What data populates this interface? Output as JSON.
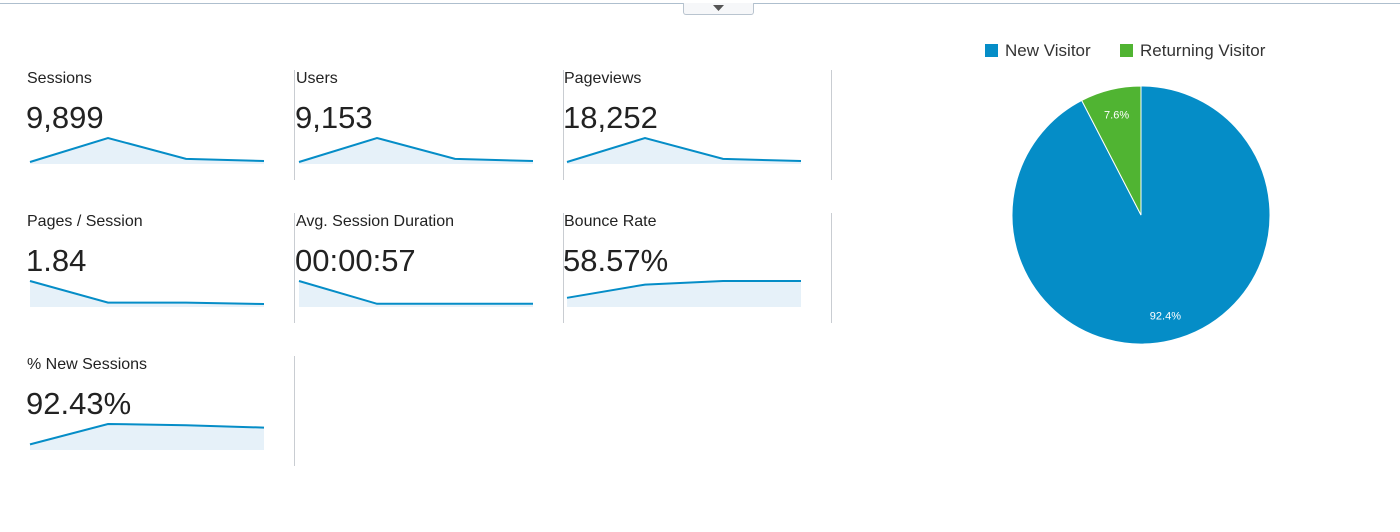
{
  "colors": {
    "new_visitor": "#058dc7",
    "returning_visitor": "#50b432",
    "sparkline": "#058dc7",
    "sparkline_fill": "#e6f1f9",
    "separator": "#c9cdd2"
  },
  "toggle": {
    "icon": "triangle-down-icon"
  },
  "metrics": [
    {
      "label": "Sessions",
      "value": "9,899",
      "trend": [
        0.0,
        1.0,
        0.13,
        0.04
      ]
    },
    {
      "label": "Users",
      "value": "9,153",
      "trend": [
        0.0,
        1.0,
        0.13,
        0.04
      ]
    },
    {
      "label": "Pageviews",
      "value": "18,252",
      "trend": [
        0.0,
        1.0,
        0.13,
        0.04
      ]
    },
    {
      "label": "Pages / Session",
      "value": "1.84",
      "trend": [
        1.0,
        0.1,
        0.1,
        0.04
      ]
    },
    {
      "label": "Avg. Session Duration",
      "value": "00:00:57",
      "trend": [
        1.0,
        0.05,
        0.05,
        0.05
      ]
    },
    {
      "label": "Bounce Rate",
      "value": "58.57%",
      "trend": [
        0.3,
        0.85,
        1.0,
        1.0
      ]
    },
    {
      "label": "% New Sessions",
      "value": "92.43%",
      "trend": [
        0.15,
        1.0,
        0.95,
        0.85
      ]
    }
  ],
  "chart_data": {
    "type": "pie",
    "legend_position": "top",
    "slices": [
      {
        "name": "New Visitor",
        "value": 92.4,
        "label": "92.4%"
      },
      {
        "name": "Returning Visitor",
        "value": 7.6,
        "label": "7.6%"
      }
    ]
  }
}
